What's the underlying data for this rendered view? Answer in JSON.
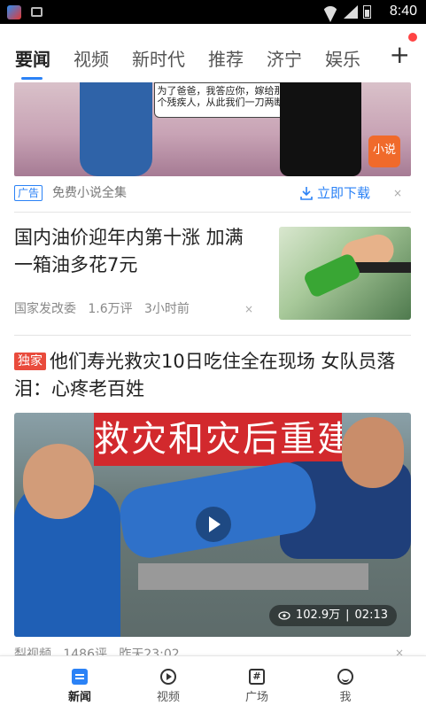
{
  "status_bar": {
    "time": "8:40"
  },
  "tabs": [
    {
      "label": "要闻",
      "active": true
    },
    {
      "label": "视频"
    },
    {
      "label": "新时代"
    },
    {
      "label": "推荐"
    },
    {
      "label": "济宁"
    },
    {
      "label": "娱乐"
    }
  ],
  "tabs_add": "+",
  "ad": {
    "bubble_text": "为了爸爸，我答应你，嫁给那个残疾人，从此我们一刀两断",
    "badge": "小说",
    "tag": "广告",
    "text": "免费小说全集",
    "download_label": "立即下载",
    "close": "×"
  },
  "news1": {
    "title": "国内油价迎年内第十涨 加满一箱油多花7元",
    "source": "国家发改委",
    "comments": "1.6万评",
    "time": "3小时前",
    "close": "×"
  },
  "news2": {
    "tag": "独家",
    "title": "他们寿光救灾10日吃住全在现场 女队员落泪：心疼老百姓",
    "video_banner": "救灾和灾后重建工作",
    "views": "102.9万",
    "duration": "02:13",
    "source": "梨视频",
    "comments": "1486评",
    "time": "昨天23:02",
    "close": "×"
  },
  "bottom_nav": [
    {
      "label": "新闻",
      "active": true
    },
    {
      "label": "视频"
    },
    {
      "label": "广场"
    },
    {
      "label": "我"
    }
  ]
}
